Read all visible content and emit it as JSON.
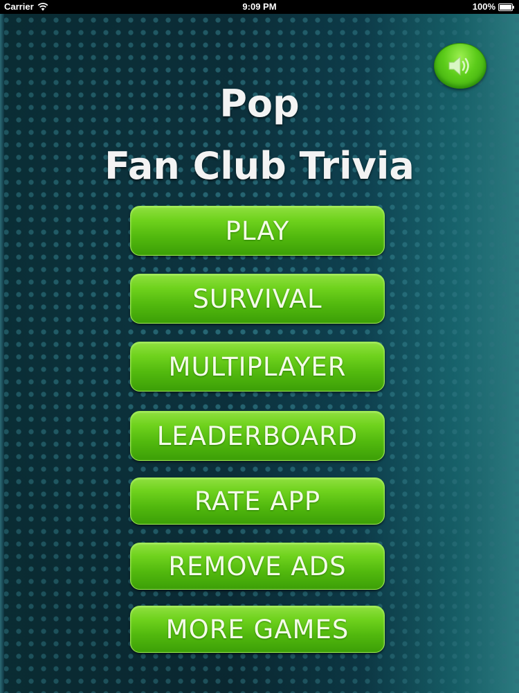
{
  "status_bar": {
    "carrier": "Carrier",
    "time": "9:09 PM",
    "battery": "100%"
  },
  "sound_button": {
    "icon": "speaker-icon",
    "state": "on"
  },
  "title": {
    "line1": "Pop",
    "line2": "Fan Club Trivia"
  },
  "menu": {
    "play": "PLAY",
    "survival": "SURVIVAL",
    "multiplayer": "MULTIPLAYER",
    "leaderboard": "LEADERBOARD",
    "rate_app": "RATE APP",
    "remove_ads": "REMOVE ADS",
    "more_games": "MORE GAMES"
  },
  "colors": {
    "button_green": "#5cc414",
    "background_teal": "#0d3a44",
    "title_text": "#f3f3f3"
  }
}
